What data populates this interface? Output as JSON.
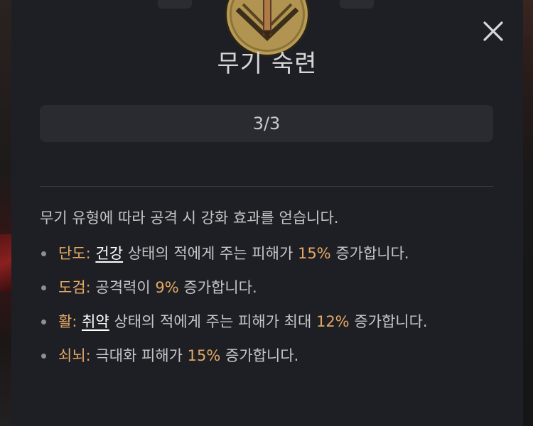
{
  "dialog": {
    "title": "무기 숙련",
    "level": "3/3",
    "description": "무기 유형에 따라 공격 시 강화 효과를 얻습니다.",
    "close_icon": "close-icon",
    "emblem_icon": "crossed-weapons-emblem-icon"
  },
  "bullets": [
    {
      "weapon": "단도:",
      "keyword": "건강",
      "text1": " 상태의 적에게 주는 피해가 ",
      "value": "15%",
      "text2": " 증가합니다."
    },
    {
      "weapon": "도검:",
      "keyword": "",
      "text1": " 공격력이 ",
      "value": "9%",
      "text2": " 증가합니다."
    },
    {
      "weapon": "활:",
      "keyword": "취약",
      "text1": " 상태의 적에게 주는 피해가 최대 ",
      "value": "12%",
      "text2": " 증가합니다."
    },
    {
      "weapon": "쇠뇌:",
      "keyword": "",
      "text1": " 극대화 피해가 ",
      "value": "15%",
      "text2": " 증가합니다."
    }
  ],
  "colors": {
    "panel_bg": "#1e1f24",
    "weapon_highlight": "#e3a866",
    "value_highlight": "#e3a866",
    "text": "#c6c6c9"
  }
}
